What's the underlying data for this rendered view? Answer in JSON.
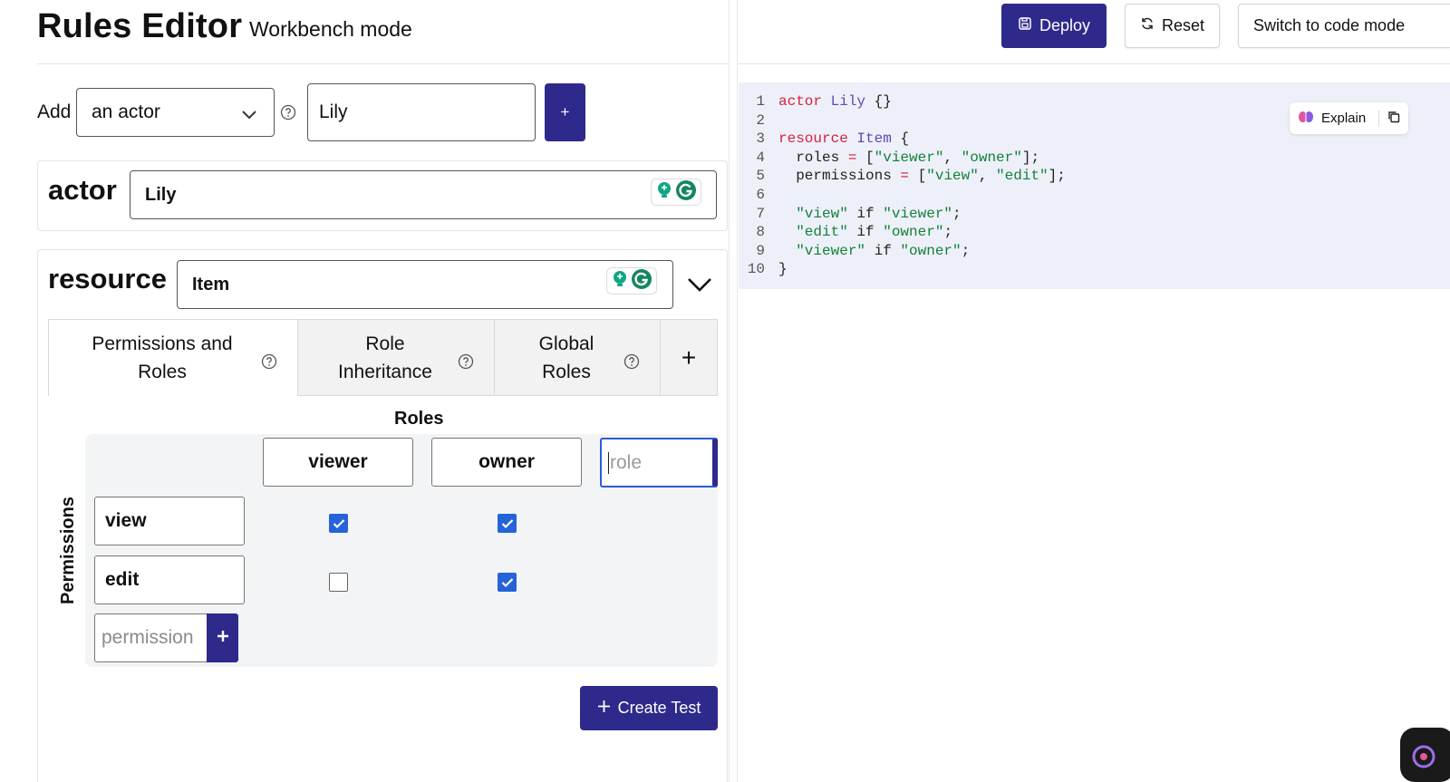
{
  "header": {
    "title": "Rules Editor",
    "subtitle": "Workbench mode",
    "deploy_label": "Deploy",
    "reset_label": "Reset",
    "switch_label": "Switch to code mode"
  },
  "add_bar": {
    "label": "Add",
    "selected_type": "an actor",
    "name_value": "Lily",
    "add_button_label": "+"
  },
  "actor_card": {
    "heading": "actor",
    "name_value": "Lily"
  },
  "resource_card": {
    "heading": "resource",
    "name_value": "Item",
    "tabs": [
      {
        "line1": "Permissions and",
        "line2": "Roles"
      },
      {
        "line1": "Role",
        "line2": "Inheritance"
      },
      {
        "line1": "Global",
        "line2": "Roles"
      }
    ],
    "add_tab_label": "+",
    "roles_title": "Roles",
    "permissions_title": "Permissions",
    "roles": [
      "viewer",
      "owner"
    ],
    "new_role_placeholder": "role",
    "permissions": [
      "view",
      "edit"
    ],
    "matrix": [
      [
        true,
        true
      ],
      [
        false,
        true
      ]
    ],
    "new_permission_placeholder": "permission",
    "create_test_label": "Create Test"
  },
  "code_panel": {
    "explain_label": "Explain",
    "line_numbers": [
      "1",
      "2",
      "3",
      "4",
      "5",
      "6",
      "7",
      "8",
      "9",
      "10"
    ]
  },
  "colors": {
    "primary": "#2e2a8c",
    "checkbox": "#2563d9",
    "code_keyword": "#d4213d",
    "code_type": "#5b4bb5",
    "code_string": "#14813a",
    "code_bg": "#edf0f8"
  }
}
